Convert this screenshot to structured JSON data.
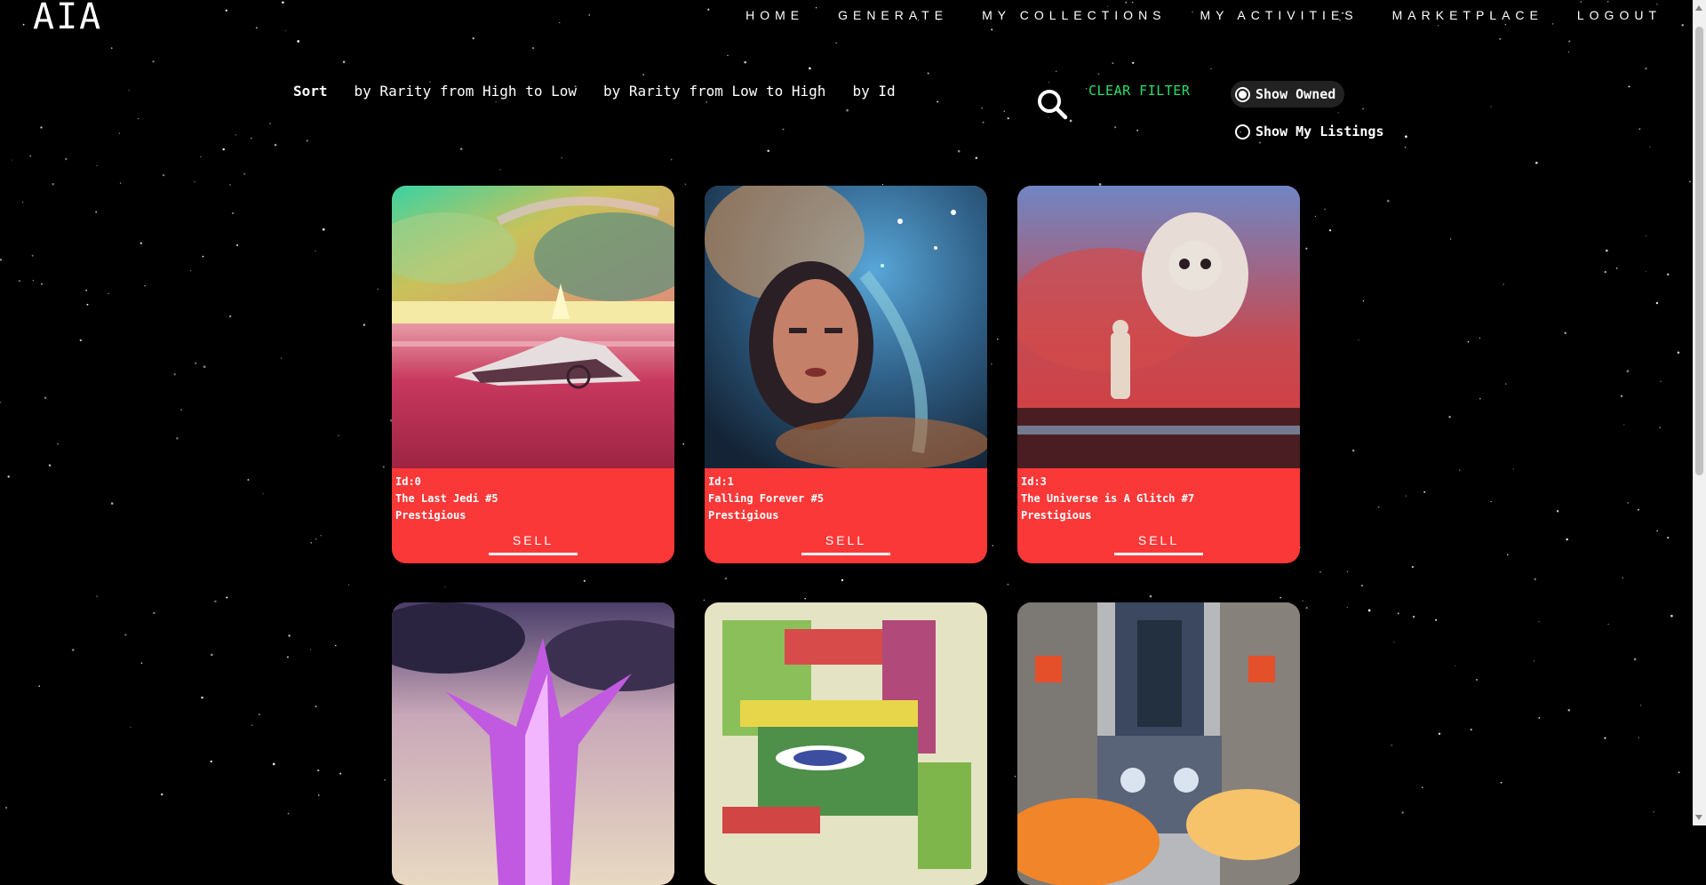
{
  "brand": "AIA",
  "nav": [
    "HOME",
    "GENERATE",
    "MY COLLECTIONS",
    "MY ACTIVITIES",
    "MARKETPLACE",
    "LOGOUT"
  ],
  "sort": {
    "label": "Sort",
    "options": [
      "by Rarity from High to Low",
      "by Rarity from Low to High",
      "by Id"
    ]
  },
  "search": {
    "icon": "search-icon"
  },
  "filter": {
    "clear_label": "CLEAR FILTER",
    "clear_color": "#28e06a",
    "show_owned": "Show Owned",
    "show_my_listings": "Show My Listings",
    "selected": "Show Owned"
  },
  "colors": {
    "card_accent": "#fa3838",
    "background": "#000000"
  },
  "cards": [
    {
      "id": "Id:0",
      "title": "The Last Jedi #5",
      "rarity": "Prestigious",
      "action": "SELL"
    },
    {
      "id": "Id:1",
      "title": "Falling Forever #5",
      "rarity": "Prestigious",
      "action": "SELL"
    },
    {
      "id": "Id:3",
      "title": "The Universe is A Glitch #7",
      "rarity": "Prestigious",
      "action": "SELL"
    },
    {
      "id": "",
      "title": "",
      "rarity": "",
      "action": ""
    },
    {
      "id": "",
      "title": "",
      "rarity": "",
      "action": ""
    },
    {
      "id": "",
      "title": "",
      "rarity": "",
      "action": ""
    }
  ]
}
